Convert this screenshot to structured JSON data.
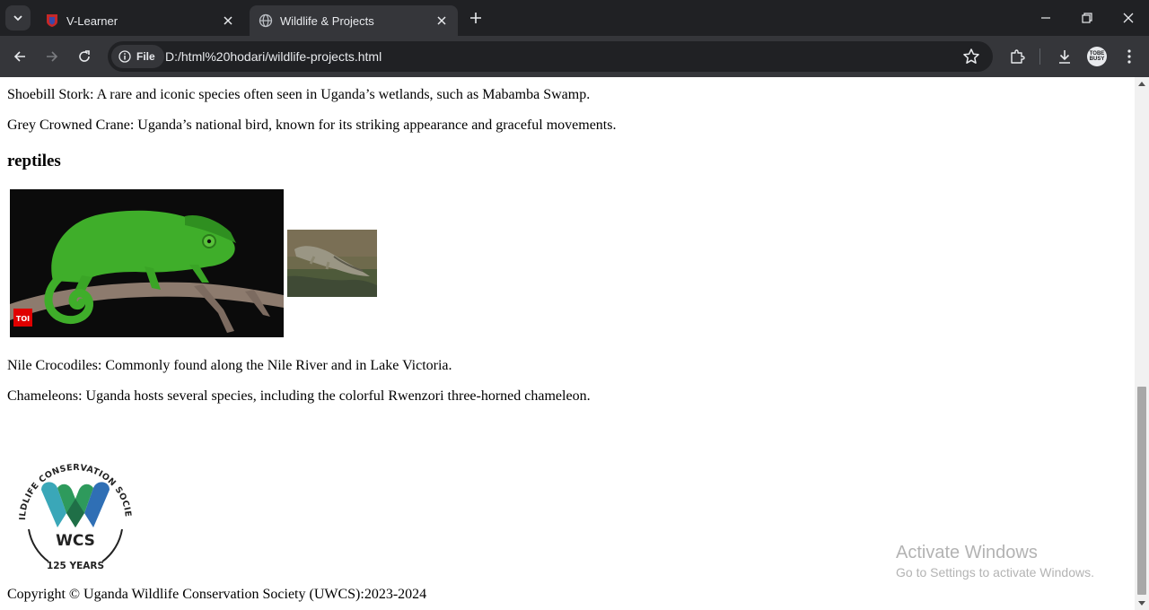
{
  "browser": {
    "tabs": [
      {
        "title": "V-Learner",
        "active": false
      },
      {
        "title": "Wildlife & Projects",
        "active": true
      }
    ],
    "address_chip": "File",
    "url": "D:/html%20hodari/wildlife-projects.html",
    "profile_badge": "TOBE BUSY"
  },
  "page": {
    "birds": [
      "Shoebill Stork: A rare and iconic species often seen in Uganda’s wetlands, such as Mabamba Swamp.",
      "Grey Crowned Crane: Uganda’s national bird, known for its striking appearance and graceful movements."
    ],
    "reptiles_heading": "reptiles",
    "chameleon_badge": "TOI",
    "reptiles": [
      "Nile Crocodiles: Commonly found along the Nile River and in Lake Victoria.",
      "Chameleons: Uganda hosts several species, including the colorful Rwenzori three-horned chameleon."
    ],
    "logo": {
      "ring_text": "WILDLIFE CONSERVATION SOCIETY",
      "initials": "WCS",
      "years": "125 YEARS"
    },
    "copyright": "Copyright © Uganda Wildlife Conservation Society (UWCS):2023-2024"
  },
  "os_watermark": {
    "title": "Activate Windows",
    "subtitle": "Go to Settings to activate Windows."
  },
  "colors": {
    "chrome_dark": "#202124",
    "chrome_toolbar": "#35363a",
    "wcs_green": "#2e9a5c",
    "wcs_teal": "#3aa7b8",
    "wcs_blue": "#2f6fb5"
  }
}
